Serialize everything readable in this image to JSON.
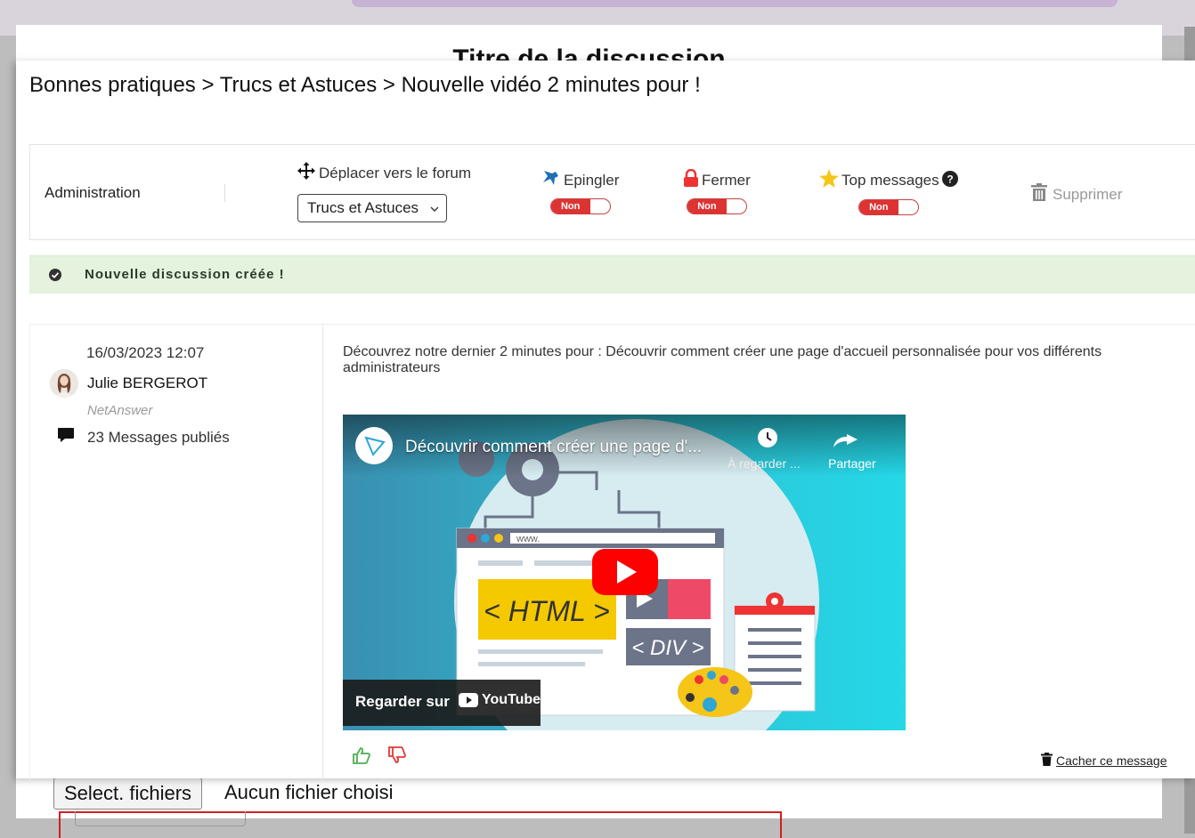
{
  "background": {
    "title": "Titre de la discussion",
    "file_button": "Select. fichiers",
    "file_status": "Aucun fichier choisi"
  },
  "breadcrumb": "Bonnes pratiques > Trucs et Astuces > Nouvelle vidéo 2 minutes pour !",
  "admin": {
    "label": "Administration",
    "move_label": "Déplacer vers le forum",
    "forum_selected": "Trucs et Astuces",
    "pin_label": "Epingler",
    "pin_value": "Non",
    "close_label": "Fermer",
    "close_value": "Non",
    "top_label": "Top messages",
    "top_value": "Non",
    "delete_label": "Supprimer"
  },
  "alert": {
    "text": "Nouvelle discussion créée !",
    "color": "#e4f2de"
  },
  "post": {
    "date": "16/03/2023 12:07",
    "author": "Julie BERGEROT",
    "company": "NetAnswer",
    "messages_count": "23 Messages publiés",
    "content": "Découvrez notre dernier 2 minutes pour : Découvrir comment créer une page d'accueil personnalisée pour vos différents administrateurs",
    "hide_label": "Cacher ce message"
  },
  "video": {
    "title": "Découvrir comment créer une page d'...",
    "watch_later": "À regarder ...",
    "share": "Partager",
    "watch_on": "Regarder sur",
    "youtube": "YouTube",
    "html_tag": "< HTML >",
    "div_tag": "< DIV >",
    "url_text": "www."
  },
  "colors": {
    "accent_red": "#dd3333",
    "pin_blue": "#1f6fb5",
    "star_yellow": "#f5c518",
    "like_green": "#4caf50",
    "dislike_red": "#e53935"
  }
}
